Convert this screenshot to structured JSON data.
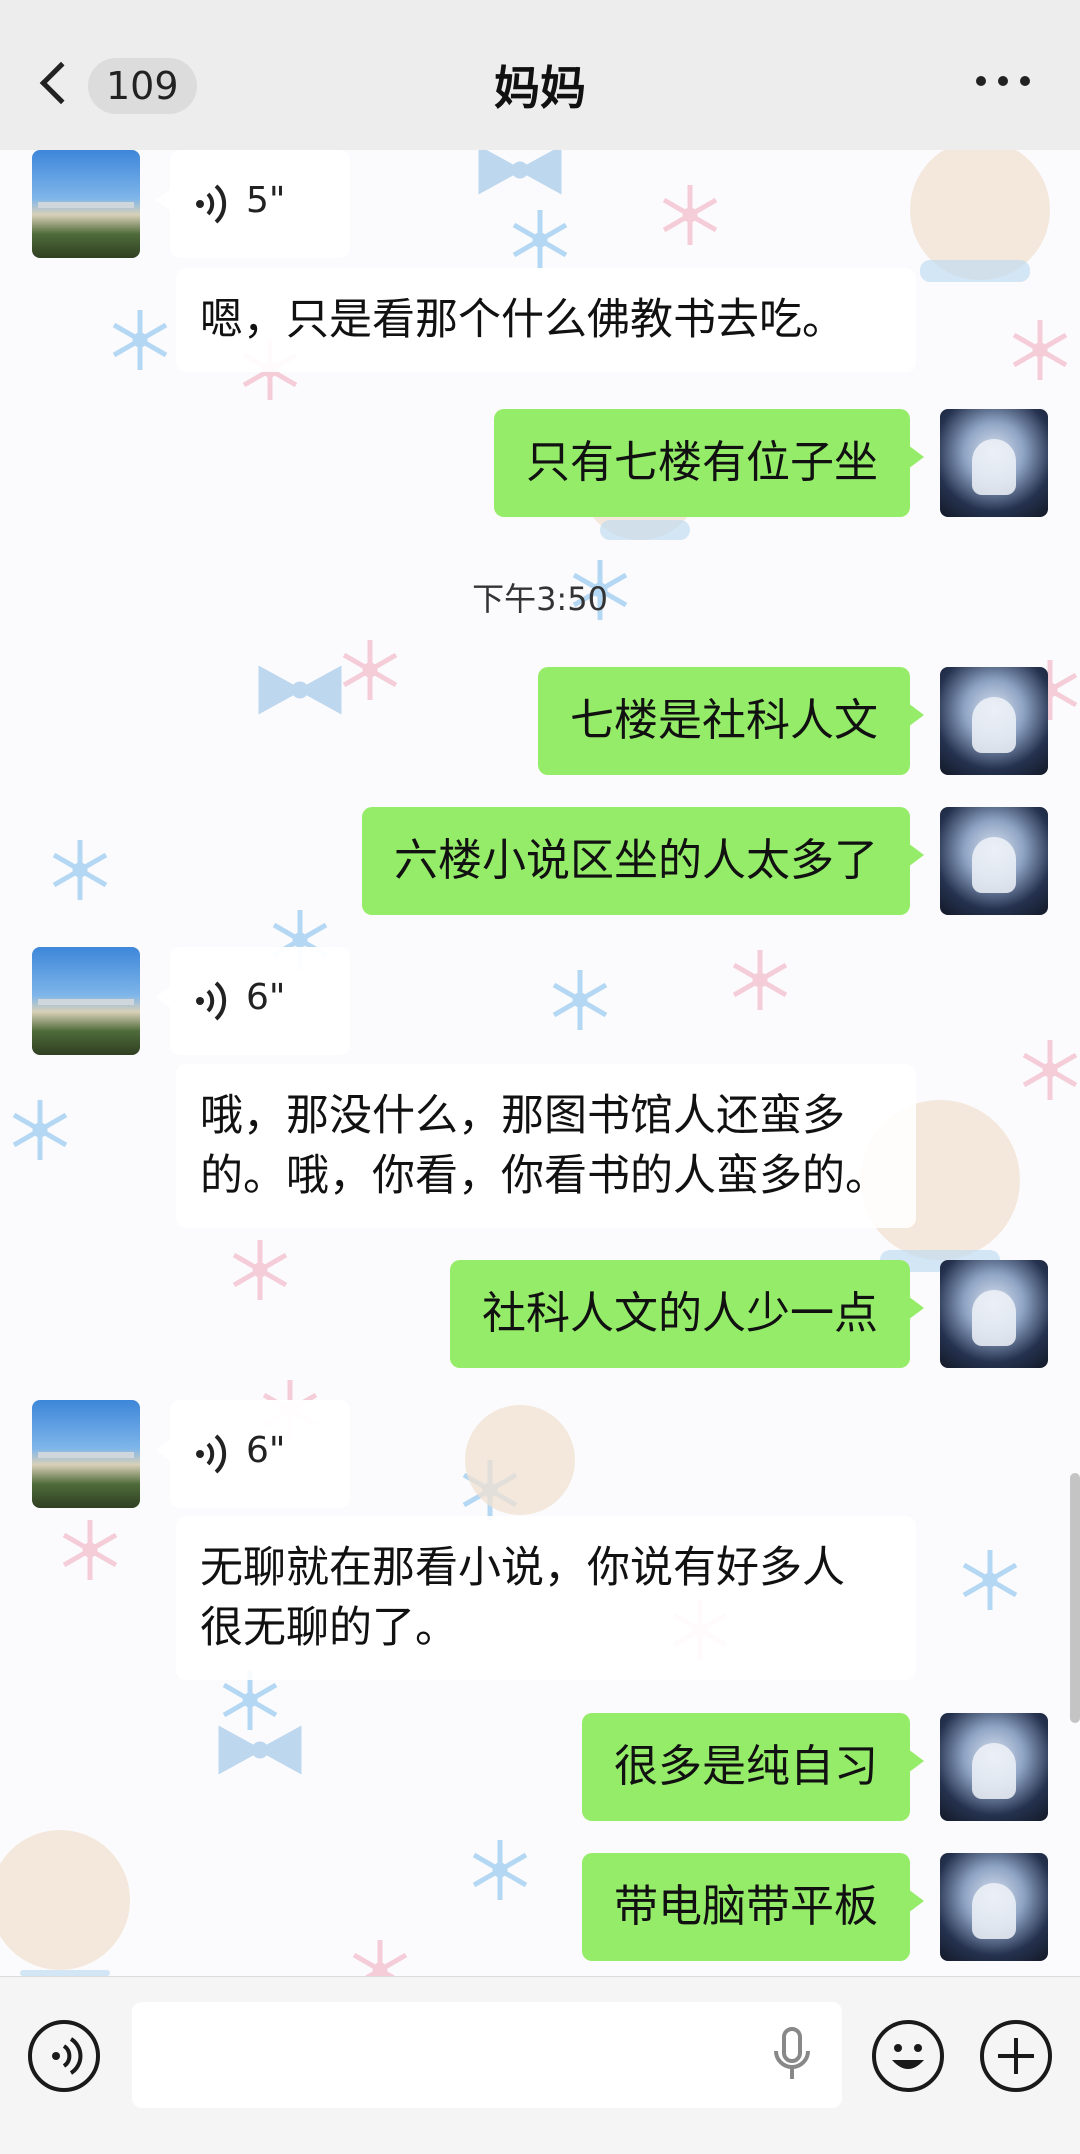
{
  "header": {
    "back_count": "109",
    "title": "妈妈",
    "more_icon": "more-dots-icon"
  },
  "messages": [
    {
      "type": "voice",
      "from": "mom",
      "duration": "5\"",
      "transcript": "嗯，只是看那个什么佛教书去吃。"
    },
    {
      "type": "text",
      "from": "me",
      "text": "只有七楼有位子坐"
    },
    {
      "type": "time",
      "text": "下午3:50"
    },
    {
      "type": "text",
      "from": "me",
      "text": "七楼是社科人文"
    },
    {
      "type": "text",
      "from": "me",
      "text": "六楼小说区坐的人太多了"
    },
    {
      "type": "voice",
      "from": "mom",
      "duration": "6\"",
      "transcript_line1": "哦，那没什么，那图书馆人还蛮多",
      "transcript_line2": "的。哦，你看，你看书的人蛮多的。"
    },
    {
      "type": "text",
      "from": "me",
      "text": "社科人文的人少一点"
    },
    {
      "type": "voice",
      "from": "mom",
      "duration": "6\"",
      "transcript_line1": "无聊就在那看小说，你说有好多人",
      "transcript_line2": "很无聊的了。"
    },
    {
      "type": "text",
      "from": "me",
      "text": "很多是纯自习"
    },
    {
      "type": "text",
      "from": "me",
      "text": "带电脑带平板"
    }
  ],
  "input_bar": {
    "voice_icon": "voice-mode-icon",
    "mic_icon": "microphone-icon",
    "emoji_icon": "emoji-icon",
    "plus_icon": "plus-icon",
    "input_value": ""
  },
  "colors": {
    "my_bubble": "#95ec69",
    "header_bg": "#ededed",
    "input_bar_bg": "#f5f5f5"
  }
}
